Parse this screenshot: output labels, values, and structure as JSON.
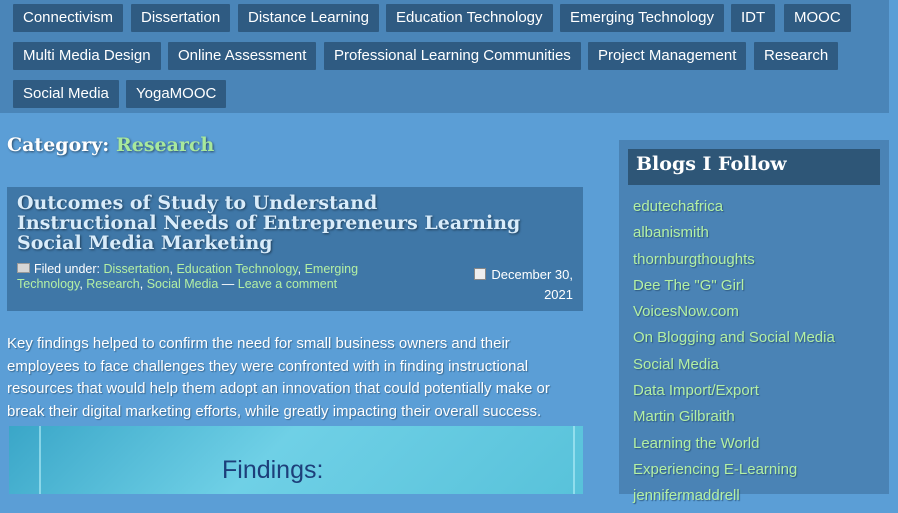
{
  "tags": [
    [
      "Connectivism",
      "Dissertation",
      "Distance Learning",
      "Education Technology",
      "Emerging Technology",
      "IDT",
      "MOOC"
    ],
    [
      "Multi Media Design",
      "Online Assessment",
      "Professional Learning Communities",
      "Project Management",
      "Research"
    ],
    [
      "Social Media",
      "YogaMOOC"
    ]
  ],
  "category": {
    "prefix": "Category:",
    "name": "Research"
  },
  "post": {
    "title": "Outcomes of Study to Understand Instructional Needs of Entrepreneurs Learning Social Media Marketing",
    "filed_under_label": "Filed under:",
    "categories": [
      "Dissertation",
      "Education Technology",
      "Emerging Technology",
      "Research",
      "Social Media"
    ],
    "separator": "—",
    "comment_link": "Leave a comment",
    "date_line1": "December 30,",
    "date_line2": "2021",
    "excerpt": "Key findings helped to confirm the need for small business owners and their employees to face challenges they were confronted with in finding instructional resources that would help them adopt an innovation that could potentially make or break their digital marketing efforts, while greatly impacting their overall success.",
    "image_title": "Findings:"
  },
  "sidebar": {
    "heading": "Blogs I Follow",
    "blogs": [
      "edutechafrica",
      "albanismith",
      "thornburgthoughts",
      "Dee The \"G\" Girl",
      "VoicesNow.com",
      "On Blogging and Social Media",
      "Social Media",
      "Data Import/Export",
      "Martin Gilbraith",
      "Learning the World",
      "Experiencing E-Learning",
      "jennifermaddrell"
    ]
  }
}
